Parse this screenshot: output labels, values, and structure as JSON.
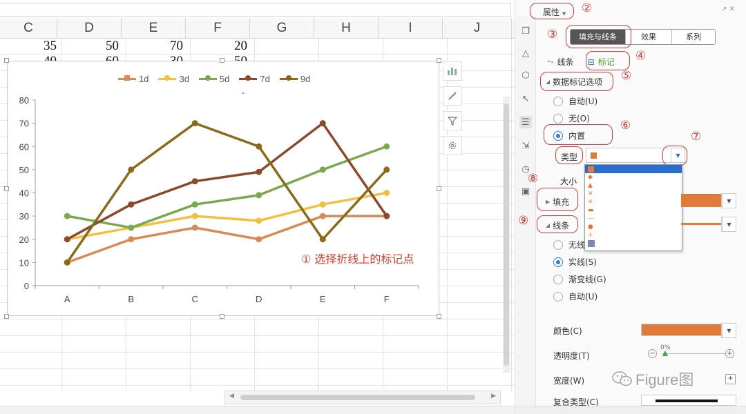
{
  "spreadsheet": {
    "columns": [
      "C",
      "D",
      "E",
      "F",
      "G",
      "H",
      "I",
      "J"
    ],
    "row1": [
      "35",
      "50",
      "70",
      "20"
    ],
    "row2": [
      "40",
      "60",
      "30",
      "50"
    ]
  },
  "chart_data": {
    "type": "line",
    "categories": [
      "A",
      "B",
      "C",
      "D",
      "E",
      "F"
    ],
    "ylim": [
      0,
      80
    ],
    "yticks": [
      "0",
      "10",
      "20",
      "30",
      "40",
      "50",
      "60",
      "70",
      "80"
    ],
    "legend_position": "top",
    "grid": false,
    "series": [
      {
        "name": "1d",
        "color": "#d98a52",
        "values": [
          10,
          20,
          25,
          20,
          30,
          30
        ]
      },
      {
        "name": "3d",
        "color": "#f2c040",
        "values": [
          20,
          25,
          30,
          28,
          35,
          40
        ]
      },
      {
        "name": "5d",
        "color": "#7aa84e",
        "values": [
          30,
          25,
          35,
          39,
          50,
          60
        ]
      },
      {
        "name": "7d",
        "color": "#8a4a2a",
        "values": [
          20,
          35,
          45,
          49,
          70,
          30
        ]
      },
      {
        "name": "9d",
        "color": "#8a6a1a",
        "values": [
          10,
          50,
          70,
          60,
          20,
          50
        ]
      }
    ]
  },
  "annotation": {
    "text": "① 选择折线上的标记点",
    "color": "#d94030"
  },
  "panel": {
    "title": "属性",
    "tabs": [
      "填充与线条",
      "效果",
      "系列"
    ],
    "subtabs": {
      "line": "线条",
      "marker": "标记"
    },
    "marker_section": "数据标记选项",
    "marker_options": {
      "auto": "自动(U)",
      "none": "无(O)",
      "builtin": "内置"
    },
    "type_label": "类型",
    "size_label": "大小",
    "fill_section": "填充",
    "line_section": "线条",
    "line_options": {
      "none": "无线",
      "solid": "实线(S)",
      "gradient": "渐变线(G)",
      "auto": "自动(U)"
    },
    "color_label": "颜色(C)",
    "transparency_label": "透明度(T)",
    "transparency_value": "0%",
    "width_label": "宽度(W)",
    "compound_label": "复合类型(C)",
    "accent_color": "#e07b3a",
    "callouts": [
      "②",
      "③",
      "④",
      "⑤",
      "⑥",
      "⑦",
      "⑧",
      "⑨"
    ]
  },
  "watermark": {
    "text": "Figure图"
  },
  "icons": [
    "chart-elements-icon",
    "brush-icon",
    "filter-icon",
    "gear-icon",
    "wechat-icon"
  ]
}
